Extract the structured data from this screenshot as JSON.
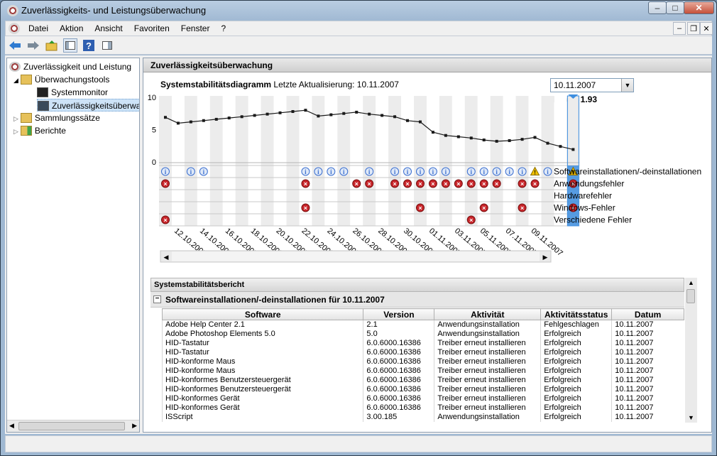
{
  "window": {
    "title": "Zuverlässigkeits- und Leistungsüberwachung"
  },
  "menu": {
    "items": [
      "Datei",
      "Aktion",
      "Ansicht",
      "Favoriten",
      "Fenster",
      "?"
    ]
  },
  "tree": {
    "root": "Zuverlässigkeit und Leistung",
    "monitoring_tools": "Überwachungstools",
    "system_monitor": "Systemmonitor",
    "reliability_monitor": "Zuverlässigkeitsüberwa",
    "collector_sets": "Sammlungssätze",
    "reports": "Berichte"
  },
  "main": {
    "header": "Zuverlässigkeitsüberwachung",
    "diagram_title": "Systemstabilitätsdiagramm",
    "last_update": "Letzte Aktualisierung: 10.11.2007",
    "selected_date": "10.11.2007",
    "index": "Index: 1.93"
  },
  "chart_data": {
    "type": "line",
    "ylim": [
      0,
      10
    ],
    "y_ticks": [
      "10",
      "5",
      "0"
    ],
    "x_tick_labels": [
      "12.10.2007",
      "14.10.2007",
      "16.10.2007",
      "18.10.2007",
      "20.10.2007",
      "22.10.2007",
      "24.10.2007",
      "26.10.2007",
      "28.10.2007",
      "30.10.2007",
      "01.11.2007",
      "03.11.2007",
      "05.11.2007",
      "07.11.2007",
      "09.11.2007"
    ],
    "x_start": "11.10.2007",
    "x_end": "10.11.2007",
    "y": [
      6.9,
      6.0,
      6.2,
      6.4,
      6.6,
      6.8,
      7.0,
      7.2,
      7.4,
      7.6,
      7.8,
      8.0,
      7.1,
      7.3,
      7.5,
      7.7,
      7.4,
      7.2,
      7.0,
      6.4,
      6.2,
      4.6,
      4.1,
      3.9,
      3.7,
      3.4,
      3.2,
      3.3,
      3.5,
      3.8,
      2.9,
      2.4,
      1.93
    ],
    "rows": [
      {
        "label": "Softwareinstallationen/-deinstallationen",
        "type": "info",
        "days": [
          0,
          2,
          3,
          11,
          12,
          13,
          14,
          16,
          18,
          19,
          20,
          21,
          22,
          24,
          25,
          26,
          27,
          28,
          30
        ],
        "warn": [
          29
        ]
      },
      {
        "label": "Anwendungsfehler",
        "type": "error",
        "days": [
          0,
          11,
          15,
          16,
          18,
          19,
          20,
          21,
          22,
          23,
          24,
          25,
          26,
          28,
          29
        ],
        "warn": []
      },
      {
        "label": "Hardwarefehler",
        "type": "none",
        "days": [],
        "warn": []
      },
      {
        "label": "Windows-Fehler",
        "type": "error",
        "days": [
          11,
          20,
          25,
          28
        ],
        "warn": []
      },
      {
        "label": "Verschiedene Fehler",
        "type": "error",
        "days": [
          0,
          24
        ],
        "warn": []
      }
    ],
    "selected_row_icons": [
      "warning",
      "error",
      "",
      "error",
      ""
    ],
    "colors": {
      "line": "#1a1a1a",
      "selected": "#3d8ee0",
      "error": "#c8262b",
      "info": "#3b6fd0",
      "warning": "#f0c000"
    }
  },
  "report": {
    "title": "Systemstabilitätsbericht",
    "section": "Softwareinstallationen/-deinstallationen für 10.11.2007",
    "columns": [
      "Software",
      "Version",
      "Aktivität",
      "Aktivitätsstatus",
      "Datum"
    ],
    "rows": [
      [
        "Adobe Help Center 2.1",
        "2.1",
        "Anwendungsinstallation",
        "Fehlgeschlagen",
        "10.11.2007"
      ],
      [
        "Adobe Photoshop Elements 5.0",
        "5.0",
        "Anwendungsinstallation",
        "Erfolgreich",
        "10.11.2007"
      ],
      [
        "HID-Tastatur",
        "6.0.6000.16386",
        "Treiber erneut installieren",
        "Erfolgreich",
        "10.11.2007"
      ],
      [
        "HID-Tastatur",
        "6.0.6000.16386",
        "Treiber erneut installieren",
        "Erfolgreich",
        "10.11.2007"
      ],
      [
        "HID-konforme Maus",
        "6.0.6000.16386",
        "Treiber erneut installieren",
        "Erfolgreich",
        "10.11.2007"
      ],
      [
        "HID-konforme Maus",
        "6.0.6000.16386",
        "Treiber erneut installieren",
        "Erfolgreich",
        "10.11.2007"
      ],
      [
        "HID-konformes Benutzersteuergerät",
        "6.0.6000.16386",
        "Treiber erneut installieren",
        "Erfolgreich",
        "10.11.2007"
      ],
      [
        "HID-konformes Benutzersteuergerät",
        "6.0.6000.16386",
        "Treiber erneut installieren",
        "Erfolgreich",
        "10.11.2007"
      ],
      [
        "HID-konformes Gerät",
        "6.0.6000.16386",
        "Treiber erneut installieren",
        "Erfolgreich",
        "10.11.2007"
      ],
      [
        "HID-konformes Gerät",
        "6.0.6000.16386",
        "Treiber erneut installieren",
        "Erfolgreich",
        "10.11.2007"
      ],
      [
        "ISScript",
        "3.00.185",
        "Anwendungsinstallation",
        "Erfolgreich",
        "10.11.2007"
      ]
    ]
  }
}
